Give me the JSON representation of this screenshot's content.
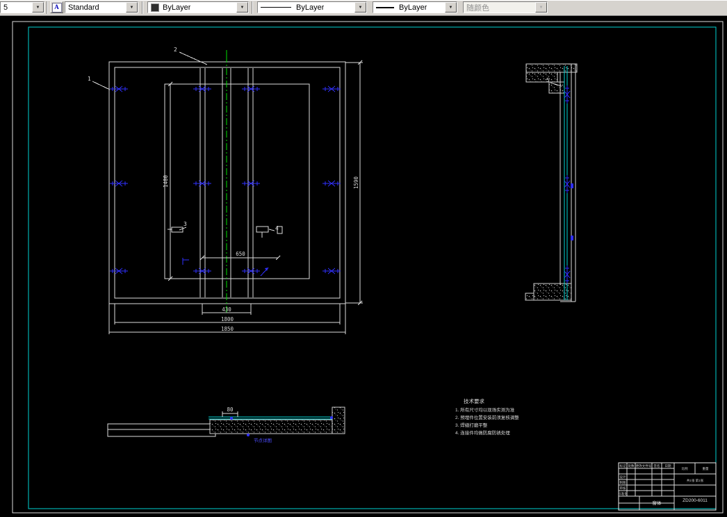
{
  "toolbar": {
    "layer_value": "5",
    "style_icon": "A",
    "style_value": "Standard",
    "color_value": "ByLayer",
    "linetype_value": "ByLayer",
    "lineweight_value": "ByLayer",
    "plotstyle_value": "随颜色"
  },
  "drawing": {
    "dims": {
      "inner_height": "1400",
      "outer_height": "1590",
      "panel_width": "650",
      "overlap_width": "430",
      "inner_width": "1800",
      "outer_width": "1850",
      "detail_width": "80"
    },
    "callouts": {
      "c1": "1",
      "c2": "2",
      "c3": "3",
      "c4": "4",
      "c5": "5"
    },
    "notes": {
      "title": "技术要求",
      "items": [
        "1. 所有尺寸均以现场实测为准",
        "2. 预埋件位置安装前须复核调整",
        "3. 焊缝打磨平整",
        "4. 连接件均做防腐防锈处理"
      ]
    },
    "detail_label": "节点详图",
    "titleblock": {
      "mark": "标记",
      "count": "处数",
      "file_no": "更改文件号",
      "sign": "签名",
      "date": "日期",
      "design": "设计",
      "draft": "制图",
      "check": "审核",
      "standardize": "标准化",
      "scale_label": "比例",
      "weight_label": "重量",
      "sheet_label": "共1张 第1张",
      "name": "窗体",
      "number": "ZD200-6011"
    }
  },
  "colors": {
    "line_white": "#dcdcdc",
    "accent_cyan": "#00d2d2",
    "accent_green": "#00e000",
    "accent_blue": "#3030ff",
    "toolbar_gray": "#d6d3ce"
  }
}
